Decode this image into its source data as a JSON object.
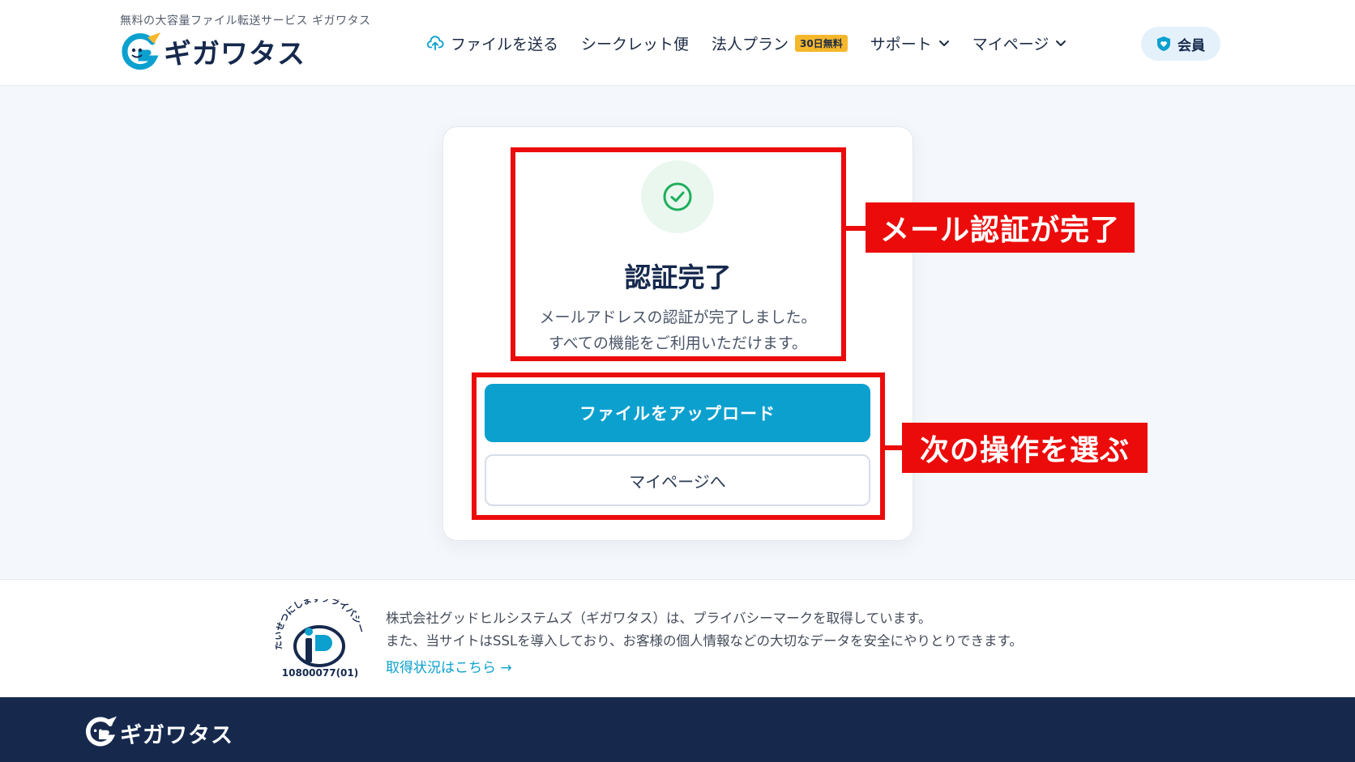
{
  "header": {
    "tagline": "無料の大容量ファイル転送サービス ギガワタス",
    "brand_name": "ギガワタス",
    "nav": {
      "send": "ファイルを送る",
      "secret": "シークレット便",
      "corporate": "法人プラン",
      "corporate_badge": "30日無料",
      "support": "サポート",
      "mypage": "マイページ"
    },
    "member_label": "会員"
  },
  "card": {
    "title": "認証完了",
    "desc_line1": "メールアドレスの認証が完了しました。",
    "desc_line2": "すべての機能をご利用いただけます。",
    "primary_button": "ファイルをアップロード",
    "secondary_button": "マイページへ"
  },
  "annotations": {
    "label1": "メール認証が完了",
    "label2": "次の操作を選ぶ"
  },
  "privacy": {
    "pmark_text": "たいせつにしますプライバシー",
    "pmark_number": "10800077(01)",
    "line1": "株式会社グッドヒルシステムズ（ギガワタス）は、プライバシーマークを取得しています。",
    "line2": "また、当サイトはSSLを導入しており、お客様の個人情報などの大切なデータを安全にやりとりできます。",
    "link": "取得状況はこちら →"
  },
  "footer": {
    "brand_name": "ギガワタス"
  },
  "colors": {
    "brand_navy": "#16294d",
    "accent_blue": "#0ca0cf",
    "annotation_red": "#ec0b0b",
    "badge_yellow": "#f5b72b",
    "success_green": "#1fae5b"
  },
  "icons": {
    "send": "cloud-upload-icon",
    "support_dropdown": "chevron-down-icon",
    "member": "shield-heart-icon",
    "success": "check-circle-icon"
  }
}
